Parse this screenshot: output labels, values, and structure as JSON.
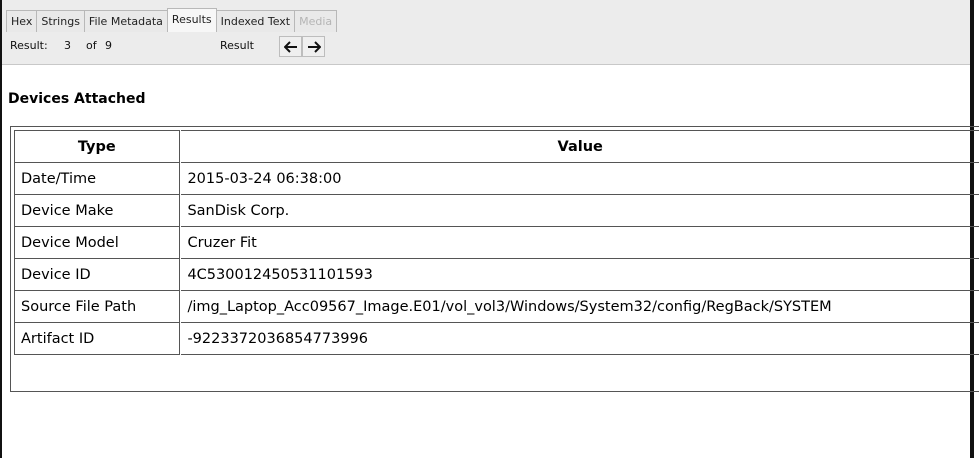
{
  "tabs": [
    {
      "label": "Hex"
    },
    {
      "label": "Strings"
    },
    {
      "label": "File Metadata"
    },
    {
      "label": "Results"
    },
    {
      "label": "Indexed Text"
    },
    {
      "label": "Media"
    }
  ],
  "nav": {
    "result_label": "Result:",
    "current": "3",
    "of_label": "of",
    "total": "9",
    "result_word": "Result",
    "prev_icon": "arrow-left-icon",
    "next_icon": "arrow-right-icon"
  },
  "section": {
    "title": "Devices Attached"
  },
  "table": {
    "headers": [
      "Type",
      "Value"
    ],
    "rows": [
      [
        "Date/Time",
        "2015-03-24 06:38:00"
      ],
      [
        "Device Make",
        "SanDisk Corp."
      ],
      [
        "Device Model",
        "Cruzer Fit"
      ],
      [
        "Device ID",
        "4C530012450531101593"
      ],
      [
        "Source File Path",
        "/img_Laptop_Acc09567_Image.E01/vol_vol3/Windows/System32/config/RegBack/SYSTEM"
      ],
      [
        "Artifact ID",
        "-9223372036854773996"
      ]
    ]
  },
  "colors": {
    "active_tab": "#f7f7f7",
    "disabled_text": "#b5b5b5",
    "border": "#555555"
  }
}
